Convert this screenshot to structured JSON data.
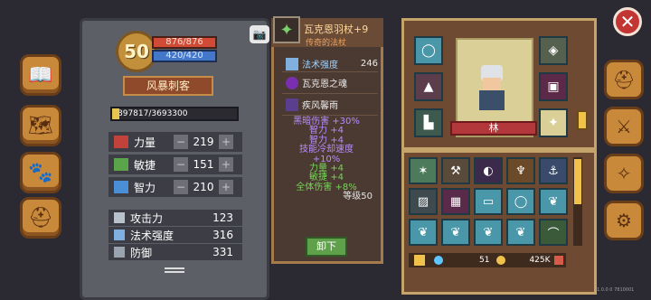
{
  "left_rail": [
    {
      "name": "book-icon",
      "glyph": "📖"
    },
    {
      "name": "map-icon",
      "glyph": "🗺"
    },
    {
      "name": "pet-icon",
      "glyph": "🐾"
    },
    {
      "name": "helmet-icon",
      "glyph": "⛑"
    }
  ],
  "character": {
    "level": "50",
    "hp": "876/876",
    "mp": "420/420",
    "class_name": "风暴刺客",
    "xp": "897817/3693300",
    "xp_progress": 0.243,
    "stats": [
      {
        "label": "力量",
        "value": "219",
        "color": "#c0423a"
      },
      {
        "label": "敏捷",
        "value": "151",
        "color": "#5aa54a"
      },
      {
        "label": "智力",
        "value": "210",
        "color": "#4a8fd6"
      }
    ],
    "attributes": [
      {
        "label": "攻击力",
        "value": "123"
      },
      {
        "label": "法术强度",
        "value": "316"
      },
      {
        "label": "防御",
        "value": "331"
      }
    ],
    "minus": "−",
    "plus": "+"
  },
  "tooltip": {
    "item_name": "瓦克恩羽杖+9",
    "item_type": "传奇的法杖",
    "power_label": "法术强度",
    "power_value": "246",
    "gems": [
      "瓦克恩之魂",
      "疾风馨雨"
    ],
    "bonuses": [
      "黑暗伤害 +30%",
      "智力 +4",
      "智力 +4",
      "技能冷却速度",
      "+10%",
      "力量 +4",
      "敏捷 +4",
      "全体伤害 +8%"
    ],
    "level_req": "等级50",
    "unequip_label": "卸下"
  },
  "equipment": {
    "character_name": "林",
    "currency": {
      "gems": "51",
      "gold": "425K"
    }
  },
  "colors": {
    "accent_gold": "#e6c650",
    "hp": "#d04a36",
    "mp": "#4277c9",
    "green_text": "#78d45a",
    "purple_text": "#b88cff"
  },
  "close": "✕",
  "version": "1.0.0.0 7810001"
}
